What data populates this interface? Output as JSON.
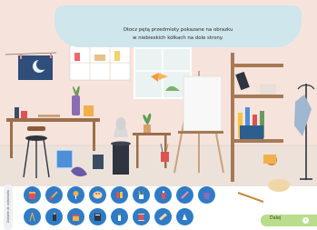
{
  "instruction": "Otocz pętą przedmioty pokazane na obrazku\nw niebieskich kółkach na dole strony.",
  "side_strip": "Zadanie do wykonania",
  "next_button": "Dalej",
  "colors": {
    "wall": "#f6e4dc",
    "floor": "#e9dfd8",
    "bubble": "#cfe6ec",
    "tool_circle": "#2f7bc6",
    "next": "#b9dd8c"
  },
  "tools": [
    {
      "name": "paint-bucket-icon"
    },
    {
      "name": "paintbrush-icon"
    },
    {
      "name": "thumbtack-icon"
    },
    {
      "name": "palette-icon"
    },
    {
      "name": "paint-tubes-icon"
    },
    {
      "name": "brush-jar-icon"
    },
    {
      "name": "spray-can-icon"
    },
    {
      "name": "pencil-icon"
    },
    {
      "name": "bucket-icon"
    },
    {
      "name": "easel-icon"
    },
    {
      "name": "bottle-icon"
    },
    {
      "name": "paint-can-icon"
    },
    {
      "name": "book-icon"
    },
    {
      "name": "marker-icon"
    },
    {
      "name": "thread-spool-icon"
    },
    {
      "name": "ruler-icon"
    },
    {
      "name": "sculpture-icon"
    }
  ]
}
